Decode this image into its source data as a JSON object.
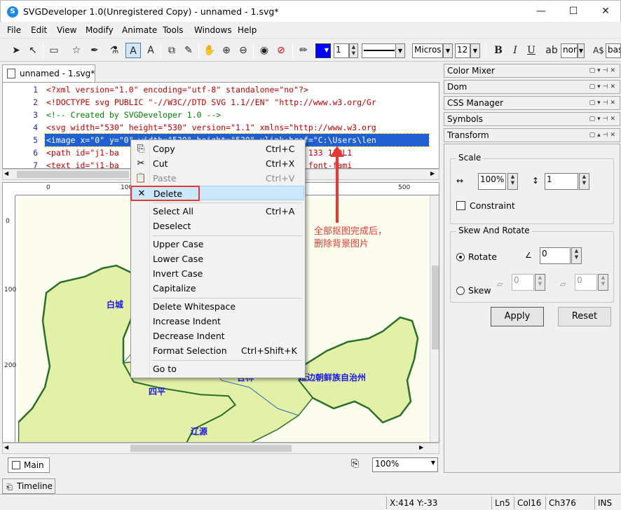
{
  "window": {
    "title": "SVGDeveloper 1.0(Unregistered Copy) - unnamed - 1.svg*",
    "minimize": "—",
    "maximize": "☐",
    "close": "✕"
  },
  "menu": [
    "File",
    "Edit",
    "View",
    "Modify",
    "Animate",
    "Tools",
    "Windows",
    "Help"
  ],
  "toolbar": {
    "stroke_width": "1",
    "font_name": "Micros",
    "font_size": "12",
    "bold": "B",
    "italic": "I",
    "underline": "U",
    "font_weight": "nor",
    "baseline": "bas",
    "fill_color": "#0000ff"
  },
  "doc_tab": {
    "label": "unnamed - 1.svg*",
    "close": "×"
  },
  "editor": {
    "line_numbers": [
      "1",
      "2",
      "3",
      "4",
      "5",
      "6",
      "7"
    ],
    "lines": [
      "<?xml version=\"1.0\" encoding=\"utf-8\" standalone=\"no\"?>",
      "<!DOCTYPE svg PUBLIC \"-//W3C//DTD SVG 1.1//EN\" \"http://www.w3.org/Gr",
      "<!-- Created by SVGDeveloper 1.0 -->",
      "<svg width=\"530\" height=\"530\" version=\"1.1\" xmlns=\"http://www.w3.org",
      "<image x=\"0\" y=\"0\" width=\"530\" height=\"530\" xlink:href=\"C:\\Users\\len",
      "<path id=\"j1-ba                           124 133 119 133 119L1",
      "<text id=\"j1-ba                           =\"preserve\" font-fami"
    ]
  },
  "ruler": {
    "h_labels": [
      "0",
      "100",
      "500"
    ],
    "v_labels": [
      "0",
      "100",
      "200"
    ]
  },
  "map": {
    "labels": [
      "白城",
      "四平",
      "辽源",
      "延边朝鲜族自治州",
      "吉林"
    ],
    "land_color": "#e2f0a8",
    "border_color": "#2a6e2a",
    "label_color": "#1a1ae0"
  },
  "context_menu": {
    "items": [
      {
        "label": "Copy",
        "shortcut": "Ctrl+C",
        "icon": "copy-icon",
        "disabled": false
      },
      {
        "label": "Cut",
        "shortcut": "Ctrl+X",
        "icon": "cut-icon",
        "disabled": false
      },
      {
        "label": "Paste",
        "shortcut": "Ctrl+V",
        "icon": "paste-icon",
        "disabled": true
      },
      {
        "label": "Delete",
        "shortcut": "",
        "icon": "delete-icon",
        "disabled": false
      },
      {
        "label": "Select All",
        "shortcut": "Ctrl+A",
        "icon": "",
        "disabled": false
      },
      {
        "label": "Deselect",
        "shortcut": "",
        "icon": "",
        "disabled": false
      },
      {
        "label": "Upper Case",
        "shortcut": "",
        "icon": "",
        "disabled": false
      },
      {
        "label": "Lower Case",
        "shortcut": "",
        "icon": "",
        "disabled": false
      },
      {
        "label": "Invert Case",
        "shortcut": "",
        "icon": "",
        "disabled": false
      },
      {
        "label": "Capitalize",
        "shortcut": "",
        "icon": "",
        "disabled": false
      },
      {
        "label": "Delete Whitespace",
        "shortcut": "",
        "icon": "",
        "disabled": false
      },
      {
        "label": "Increase Indent",
        "shortcut": "",
        "icon": "",
        "disabled": false
      },
      {
        "label": "Decrease Indent",
        "shortcut": "",
        "icon": "",
        "disabled": false
      },
      {
        "label": "Format Selection",
        "shortcut": "Ctrl+Shift+K",
        "icon": "",
        "disabled": false
      },
      {
        "label": "Go to",
        "shortcut": "",
        "icon": "",
        "disabled": false
      }
    ],
    "highlighted": "Delete"
  },
  "annotation": {
    "text_line1": "全部抠图完成后，",
    "text_line2": "删除背景图片",
    "color": "#e53935"
  },
  "bottom": {
    "main_tab": "Main",
    "zoom": "100%",
    "timeline": "Timeline"
  },
  "panels": [
    "Color Mixer",
    "Dom",
    "CSS Manager",
    "Symbols",
    "Transform"
  ],
  "transform": {
    "scale_label": "Scale",
    "scale_x": "100%",
    "scale_y": "1",
    "constraint": "Constraint",
    "skew_rotate_label": "Skew And Rotate",
    "rotate_label": "Rotate",
    "rotate_value": "0",
    "skew_label": "Skew",
    "skew_x": "0",
    "skew_y": "0",
    "apply": "Apply",
    "reset": "Reset"
  },
  "status": {
    "coords": "X:414  Y:-33",
    "line": "Ln5",
    "col": "Col16",
    "ch": "Ch376",
    "mode": "INS"
  }
}
